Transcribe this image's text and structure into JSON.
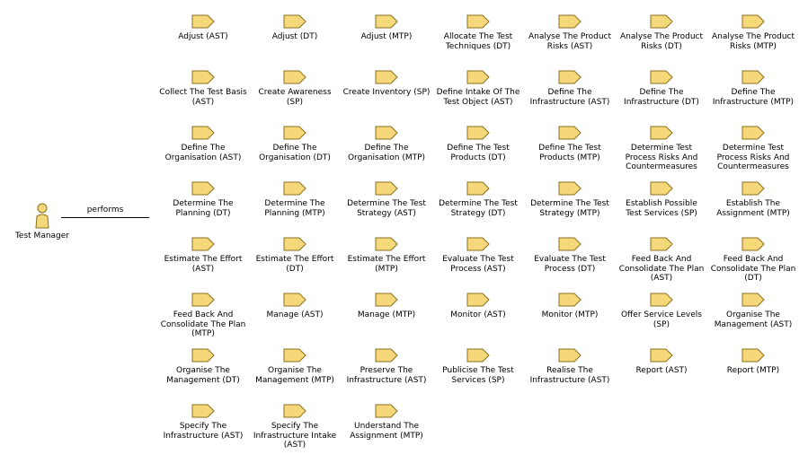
{
  "actor": {
    "name": "Test Manager",
    "icon": "business-actor-icon"
  },
  "relation": {
    "label": "performs"
  },
  "colors": {
    "process_fill": "#f5d87a",
    "process_stroke": "#8a7020",
    "actor_fill": "#f5d87a",
    "line": "#000000"
  },
  "processes": [
    "Adjust (AST)",
    "Adjust (DT)",
    "Adjust (MTP)",
    "Allocate The Test Techniques (DT)",
    "Analyse The Product Risks (AST)",
    "Analyse The Product Risks (DT)",
    "Analyse The Product Risks (MTP)",
    "Collect The Test Basis (AST)",
    "Create Awareness (SP)",
    "Create Inventory (SP)",
    "Define Intake Of The Test Object (AST)",
    "Define The Infrastructure (AST)",
    "Define The Infrastructure (DT)",
    "Define The Infrastructure (MTP)",
    "Define The Organisation (AST)",
    "Define The Organisation (DT)",
    "Define The Organisation (MTP)",
    "Define The Test Products (DT)",
    "Define The Test Products (MTP)",
    "Determine Test Process Risks And Countermeasures",
    "Determine Test Process Risks And Countermeasures",
    "Determine The Planning (DT)",
    "Determine The Planning (MTP)",
    "Determine The Test Strategy (AST)",
    "Determine The Test Strategy (DT)",
    "Determine The Test Strategy (MTP)",
    "Establish Possible Test Services (SP)",
    "Establish The Assignment (MTP)",
    "Estimate The Effort (AST)",
    "Estimate The Effort (DT)",
    "Estimate The Effort (MTP)",
    "Evaluate The Test Process (AST)",
    "Evaluate The Test Process (DT)",
    "Feed Back And Consolidate The Plan (AST)",
    "Feed Back And Consolidate The Plan (DT)",
    "Feed Back And Consolidate The Plan (MTP)",
    "Manage (AST)",
    "Manage (MTP)",
    "Monitor (AST)",
    "Monitor (MTP)",
    "Offer Service Levels (SP)",
    "Organise The Management (AST)",
    "Organise The Management (DT)",
    "Organise The Management (MTP)",
    "Preserve The Infrastructure (AST)",
    "Publicise The Test Services (SP)",
    "Realise The Infrastructure (AST)",
    "Report (AST)",
    "Report (MTP)",
    "Specify The Infrastructure (AST)",
    "Specify The Infrastructure Intake (AST)",
    "Understand The Assignment (MTP)"
  ]
}
